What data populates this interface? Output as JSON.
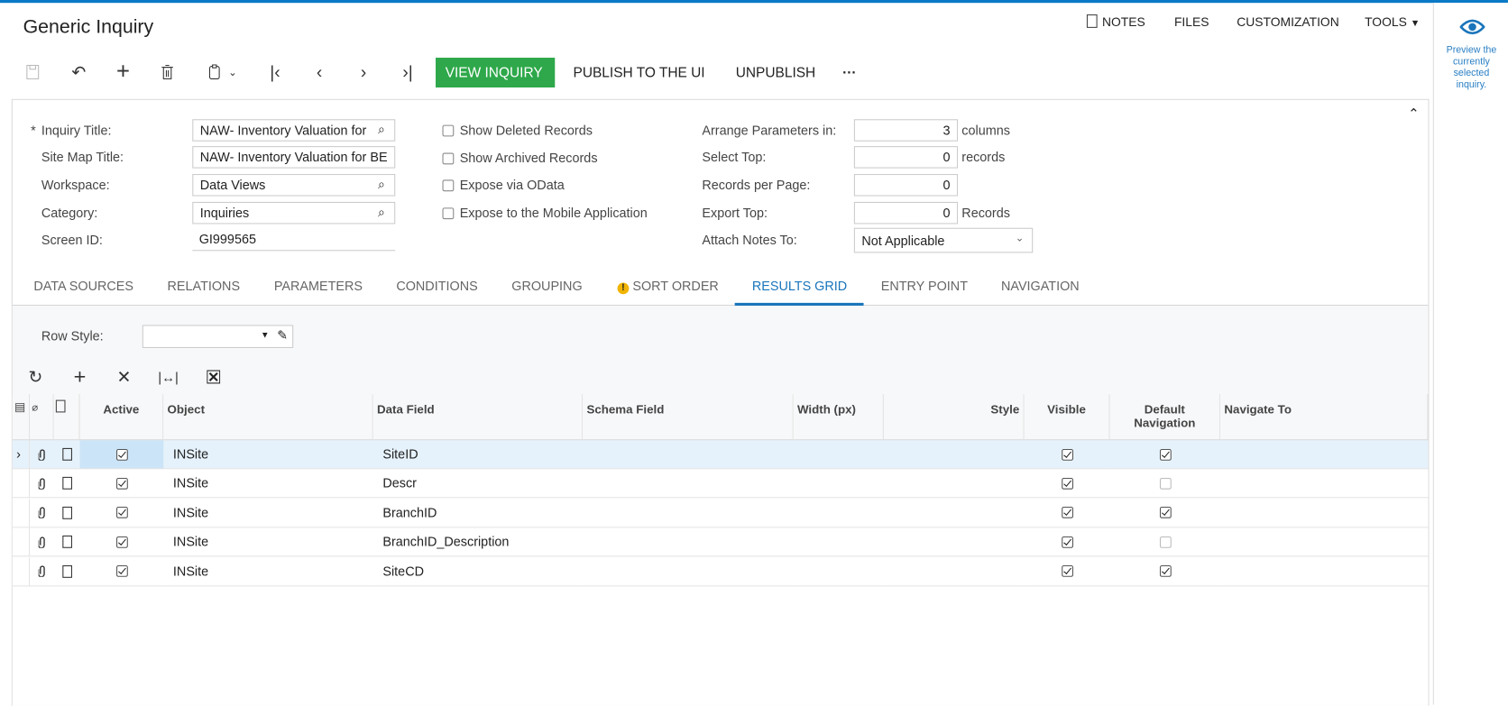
{
  "app": {
    "title": "Generic Inquiry",
    "accent": "#0a79c6",
    "primary_button_color": "#2ea84a"
  },
  "topnav": {
    "notes": "NOTES",
    "files": "FILES",
    "customization": "CUSTOMIZATION",
    "tools": "TOOLS"
  },
  "side_panel": {
    "icon": "eye-icon",
    "text": "Preview the currently selected inquiry."
  },
  "toolbar": {
    "icons": [
      "save-icon",
      "undo-icon",
      "add-icon",
      "delete-icon",
      "clipboard-icon",
      "first-icon",
      "prev-icon",
      "next-icon",
      "last-icon"
    ],
    "view_inquiry": "VIEW INQUIRY",
    "publish": "PUBLISH TO THE UI",
    "unpublish": "UNPUBLISH",
    "more": "···"
  },
  "form": {
    "inquiry_title": {
      "label": "Inquiry Title:",
      "required": "*",
      "value": "NAW- Inventory Valuation for"
    },
    "site_map_title": {
      "label": "Site Map Title:",
      "value": "NAW- Inventory Valuation for BE"
    },
    "workspace": {
      "label": "Workspace:",
      "value": "Data Views"
    },
    "category": {
      "label": "Category:",
      "value": "Inquiries"
    },
    "screen_id": {
      "label": "Screen ID:",
      "value": "GI999565"
    },
    "checkboxes": [
      {
        "label": "Show Deleted Records",
        "checked": false
      },
      {
        "label": "Show Archived Records",
        "checked": false
      },
      {
        "label": "Expose via OData",
        "checked": false
      },
      {
        "label": "Expose to the Mobile Application",
        "checked": false
      }
    ],
    "arrange": {
      "label": "Arrange Parameters in:",
      "value": "3",
      "suffix": "columns"
    },
    "select_top": {
      "label": "Select Top:",
      "value": "0",
      "suffix": "records"
    },
    "records_per_page": {
      "label": "Records per Page:",
      "value": "0"
    },
    "export_top": {
      "label": "Export Top:",
      "value": "0",
      "suffix": "Records"
    },
    "attach_notes": {
      "label": "Attach Notes To:",
      "value": "Not Applicable"
    }
  },
  "tabs": [
    "DATA SOURCES",
    "RELATIONS",
    "PARAMETERS",
    "CONDITIONS",
    "GROUPING",
    "SORT ORDER",
    "RESULTS GRID",
    "ENTRY POINT",
    "NAVIGATION"
  ],
  "active_tab": "RESULTS GRID",
  "row_style": {
    "label": "Row Style:",
    "value": ""
  },
  "grid": {
    "columns": [
      "Active",
      "Object",
      "Data Field",
      "Schema Field",
      "Width (px)",
      "Style",
      "Visible",
      "Default Navigation",
      "Navigate To"
    ],
    "rows": [
      {
        "active": true,
        "object": "INSite",
        "data_field": "SiteID",
        "schema_field": "",
        "width": "",
        "style": "",
        "visible": true,
        "default_navigation": true,
        "navigate_to": ""
      },
      {
        "active": true,
        "object": "INSite",
        "data_field": "Descr",
        "schema_field": "",
        "width": "",
        "style": "",
        "visible": true,
        "default_navigation": false,
        "navigate_to": ""
      },
      {
        "active": true,
        "object": "INSite",
        "data_field": "BranchID",
        "schema_field": "",
        "width": "",
        "style": "",
        "visible": true,
        "default_navigation": true,
        "navigate_to": ""
      },
      {
        "active": true,
        "object": "INSite",
        "data_field": "BranchID_Description",
        "schema_field": "",
        "width": "",
        "style": "",
        "visible": true,
        "default_navigation": false,
        "navigate_to": ""
      },
      {
        "active": true,
        "object": "INSite",
        "data_field": "SiteCD",
        "schema_field": "",
        "width": "",
        "style": "",
        "visible": true,
        "default_navigation": true,
        "navigate_to": ""
      }
    ]
  }
}
